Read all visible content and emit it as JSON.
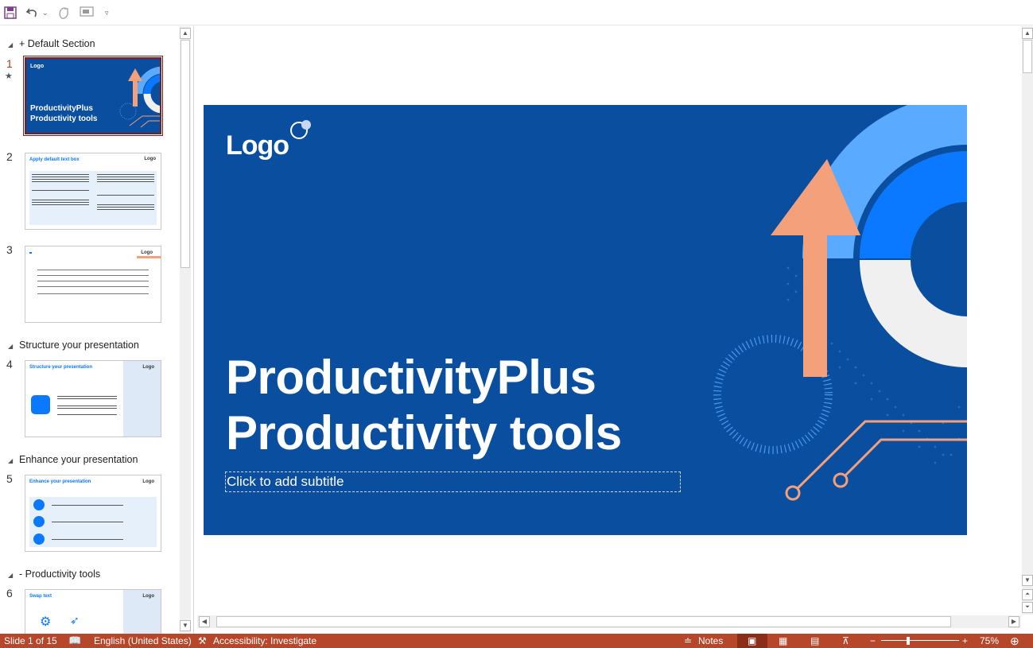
{
  "qat": {
    "save_icon": "save-icon",
    "undo_icon": "undo-icon",
    "redo_icon": "redo-icon",
    "present_icon": "present-icon",
    "customize_icon": "customize-icon"
  },
  "sections": [
    {
      "label": "+ Default Section"
    },
    {
      "label": "Structure your presentation"
    },
    {
      "label": "Enhance your presentation"
    },
    {
      "label": "- Productivity tools"
    }
  ],
  "slides": [
    {
      "num": "1",
      "title_line1": "ProductivityPlus",
      "title_line2": "Productivity tools",
      "logo": "Logo"
    },
    {
      "num": "2",
      "title": "Apply default text box",
      "logo": "Logo"
    },
    {
      "num": "3",
      "logo": "Logo"
    },
    {
      "num": "4",
      "title": "Structure your presentation",
      "logo": "Logo"
    },
    {
      "num": "5",
      "title": "Enhance your presentation",
      "logo": "Logo"
    },
    {
      "num": "6",
      "title": "Swap text",
      "logo": "Logo"
    }
  ],
  "main_slide": {
    "logo": "Logo",
    "title_line1": "ProductivityPlus",
    "title_line2": "Productivity tools",
    "subtitle_placeholder": "Click to add subtitle"
  },
  "status": {
    "slide_count": "Slide 1 of 15",
    "language": "English (United States)",
    "accessibility": "Accessibility: Investigate",
    "notes": "Notes",
    "zoom": "75%",
    "zoom_minus": "−",
    "zoom_plus": "+"
  },
  "colors": {
    "slide_bg": "#0a4ea0",
    "accent_orange": "#f4a07a",
    "light_blue": "#5aabff",
    "mid_blue": "#0a78ff",
    "status_bar": "#b7472a"
  }
}
